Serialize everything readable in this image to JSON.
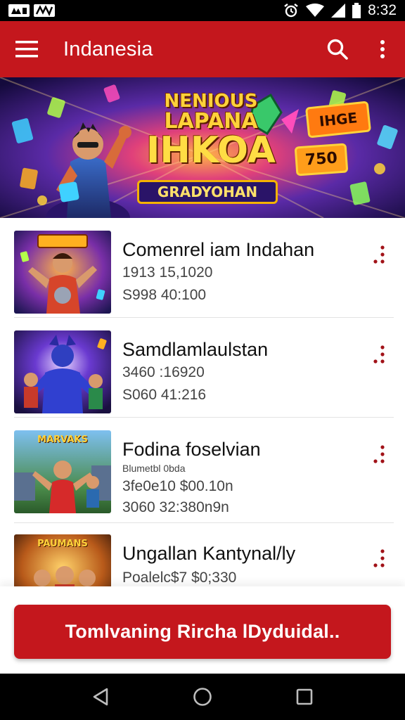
{
  "status_bar": {
    "time": "8:32",
    "left_icons": [
      "notification-icon",
      "notification-icon"
    ],
    "right_icons": [
      "alarm-icon",
      "wifi-icon",
      "signal-icon",
      "battery-icon"
    ]
  },
  "app_bar": {
    "title": "Indanesia",
    "menu_icon": "menu-icon",
    "search_icon": "search-icon",
    "more_icon": "more-vert-icon",
    "color": "#c4171d"
  },
  "banner": {
    "title_line1": "NENIOUS",
    "title_line2": "LAPANA",
    "title_line3": "IHKOA",
    "subtitle": "GRADYOHAN",
    "tag_1": "IHGE",
    "tag_2": "750"
  },
  "games": [
    {
      "thumb_label": "",
      "title": "Comenrel iam Indahan",
      "line1": "1913 15,1020",
      "line2": "S998 40:100",
      "small": ""
    },
    {
      "thumb_label": "",
      "title": "Samdlamlaulstan",
      "line1": "3460 :16920",
      "line2": "S060 41:216",
      "small": ""
    },
    {
      "thumb_label": "MARVAKS",
      "title": "Fodina foselvian",
      "small": "Blumetbl 0bda",
      "line1": "3fe0e10 $00.10n",
      "line2": "3060 32:380n9n"
    },
    {
      "thumb_label": "PAUMANS",
      "title": "Ungallan Kantynal/ly",
      "line1": "Poalelc$7 $0;330",
      "line2": "",
      "small": ""
    }
  ],
  "cta": {
    "label": "Tomlvaning Rircha lDyduidal.."
  },
  "nav_bar": {
    "back_icon": "back-triangle-icon",
    "home_icon": "home-circle-icon",
    "recents_icon": "recents-square-icon"
  }
}
